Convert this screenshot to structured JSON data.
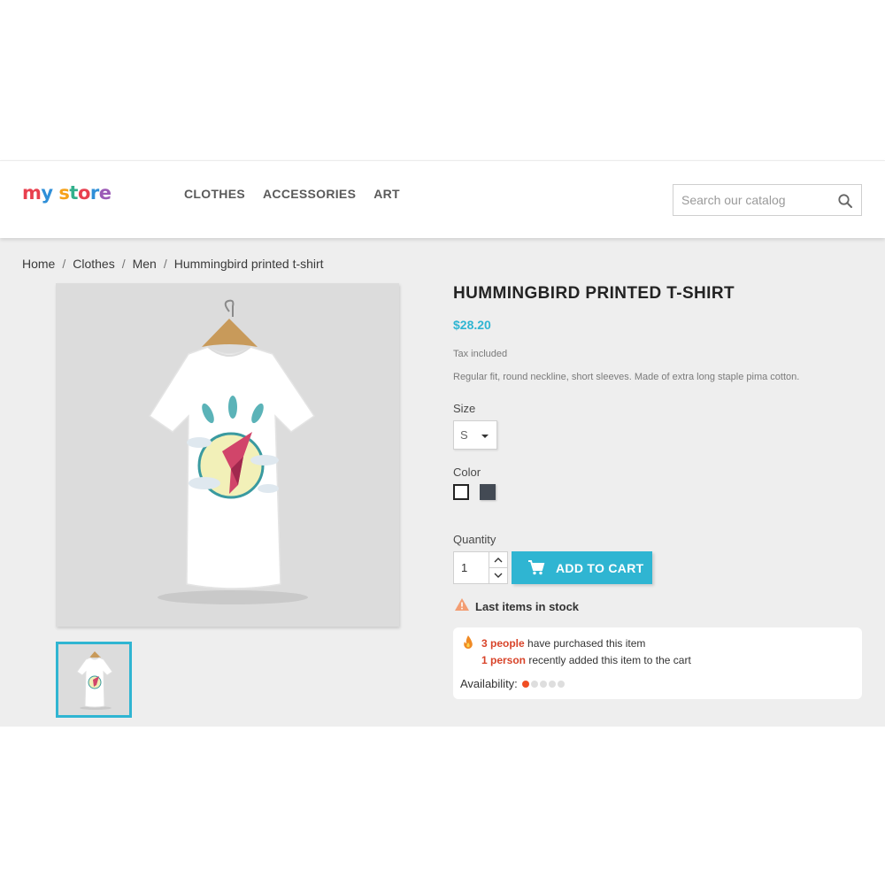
{
  "header": {
    "logo": {
      "parts": [
        {
          "text": "m",
          "color": "#e8404f"
        },
        {
          "text": "y",
          "color": "#2f8fd8"
        },
        {
          "text": " ",
          "color": "#000000"
        },
        {
          "text": "s",
          "color": "#f6a21a"
        },
        {
          "text": "t",
          "color": "#32b08c"
        },
        {
          "text": "o",
          "color": "#e8404f"
        },
        {
          "text": "r",
          "color": "#2f8fd8"
        },
        {
          "text": "e",
          "color": "#9b59b6"
        }
      ]
    },
    "nav": [
      "CLOTHES",
      "ACCESSORIES",
      "ART"
    ],
    "search_placeholder": "Search our catalog",
    "search_icon": "search-icon"
  },
  "breadcrumb": [
    "Home",
    "Clothes",
    "Men",
    "Hummingbird printed t-shirt"
  ],
  "product": {
    "title": "HUMMINGBIRD PRINTED T-SHIRT",
    "price": "$28.20",
    "tax": "Tax included",
    "description": "Regular fit, round neckline, short sleeves. Made of extra long staple pima cotton.",
    "size_label": "Size",
    "size_value": "S",
    "color_label": "Color",
    "colors": [
      "#ffffff",
      "#434a54"
    ],
    "quantity_label": "Quantity",
    "quantity_value": "1",
    "add_to_cart": "ADD TO CART",
    "stock_message": "Last items in stock"
  },
  "social_proof": {
    "purchased_count": "3 people",
    "purchased_text": " have purchased this item",
    "added_count": "1 person",
    "added_text": " recently added this item to the cart",
    "availability_label": "Availability:",
    "availability_level": 0.2
  },
  "colors": {
    "accent": "#2fb5d2",
    "highlight": "#d8442a",
    "warning": "#f39d72"
  }
}
